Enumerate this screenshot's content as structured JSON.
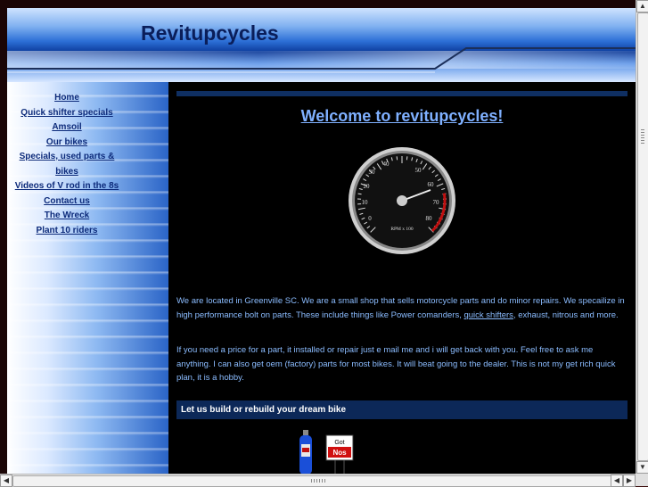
{
  "site": {
    "title": "Revitupcycles"
  },
  "nav": [
    {
      "label": "Home"
    },
    {
      "label": "Quick shifter specials"
    },
    {
      "label": "Amsoil"
    },
    {
      "label": "Our bikes"
    },
    {
      "label": "Specials, used parts & bikes"
    },
    {
      "label": "Videos of V rod in the 8s"
    },
    {
      "label": "Contact us"
    },
    {
      "label": "The Wreck"
    },
    {
      "label": "Plant 10 riders"
    }
  ],
  "main": {
    "welcome": "Welcome to revitupcycles!",
    "gauge": {
      "tick_labels": [
        "0",
        "10",
        "20",
        "30",
        "40",
        "50",
        "60",
        "70",
        "80"
      ],
      "unit_label": "RPM x 100"
    },
    "para1_before": "We are located in Greenville SC.  We are a small shop that sells motorcycle parts and do minor repairs. We specailize in high performance bolt on parts. These include things like Power comanders, ",
    "para1_link": "quick shifters",
    "para1_after": ", exhaust, nitrous and more.",
    "para2": "If you need a price for a part, it installed or repair just e mail me and i will get back with you. Feel free to ask me anything. I can also get oem (factory) parts for most bikes. It will beat going to the dealer. This is not my get rich quick plan,  it is a hobby.",
    "dream_bar": "Let us build or rebuild your dream bike",
    "nos_sign": {
      "line1": "Got",
      "line2": "Nos"
    }
  },
  "colors": {
    "nav_link": "#0c2a7a",
    "body_text": "#8bbcff",
    "content_bg": "#000000",
    "bar_bg": "#0c2858"
  }
}
